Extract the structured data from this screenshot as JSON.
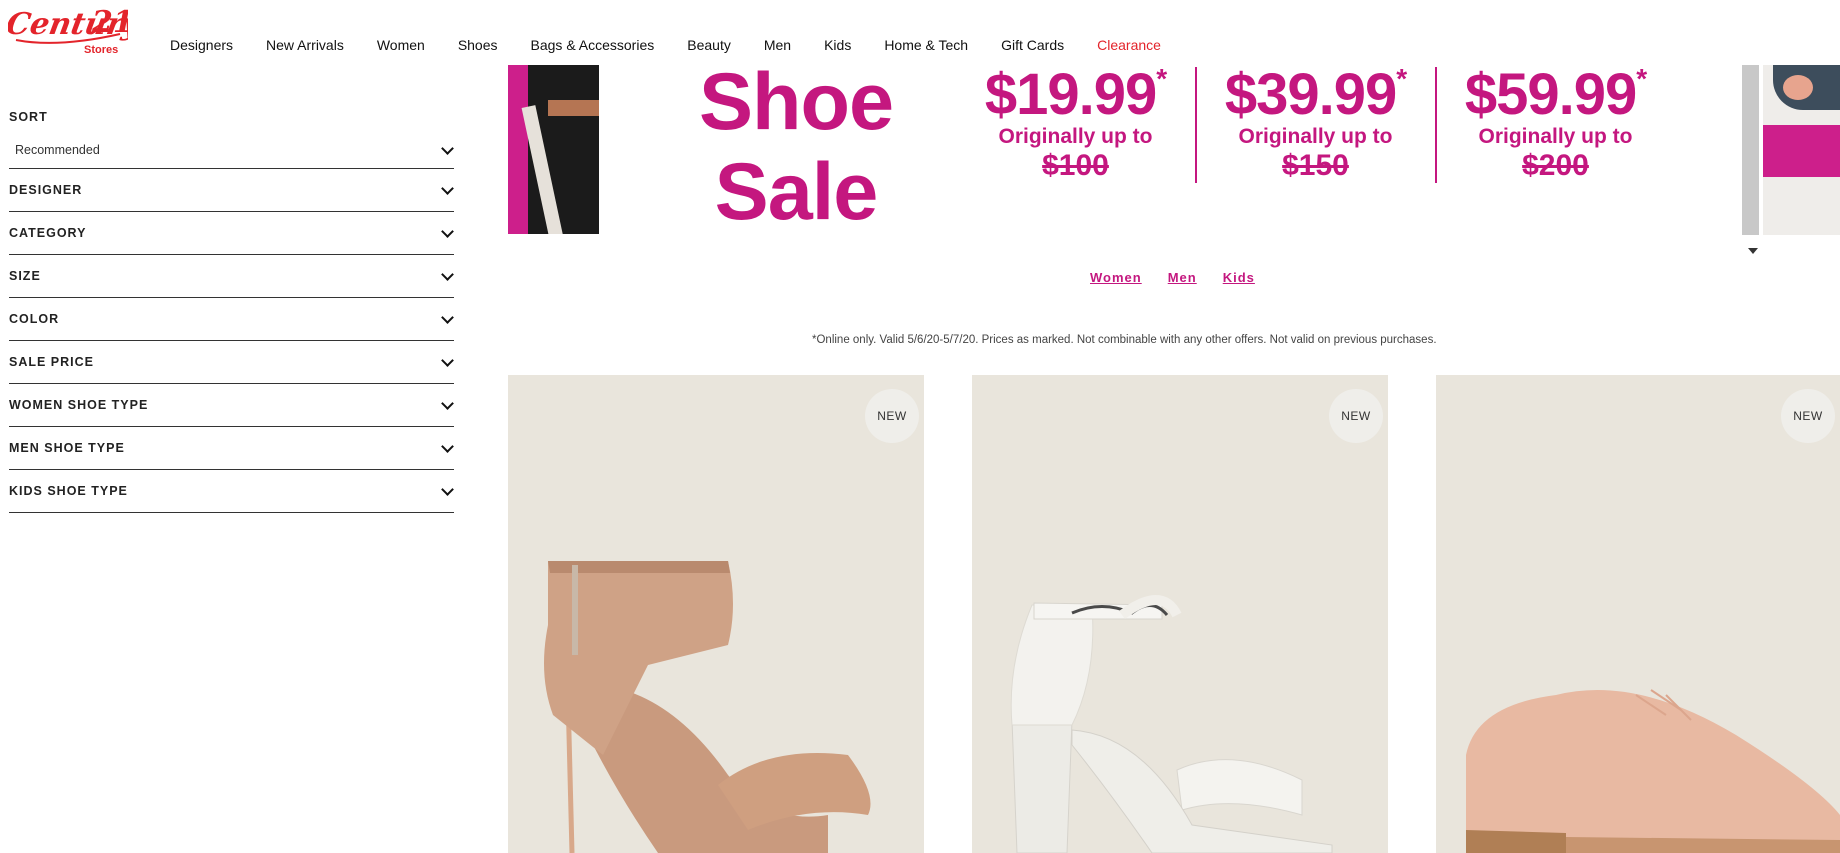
{
  "header": {
    "logo_text": "Century 21",
    "logo_sub": "Stores",
    "nav": [
      "Designers",
      "New Arrivals",
      "Women",
      "Shoes",
      "Bags & Accessories",
      "Beauty",
      "Men",
      "Kids",
      "Home & Tech",
      "Gift Cards",
      "Clearance"
    ]
  },
  "sidebar": {
    "sort_label": "SORT",
    "sort_value": "Recommended",
    "filters": [
      "DESIGNER",
      "CATEGORY",
      "SIZE",
      "COLOR",
      "SALE PRICE",
      "WOMEN SHOE TYPE",
      "MEN SHOE TYPE",
      "KIDS SHOE TYPE"
    ]
  },
  "banner": {
    "title_line1": "Shoe",
    "title_line2": "Sale",
    "asterisk": "*",
    "deals": [
      {
        "price": "$19.99",
        "orig_label": "Originally up to",
        "was": "$100"
      },
      {
        "price": "$39.99",
        "orig_label": "Originally up to",
        "was": "$150"
      },
      {
        "price": "$59.99",
        "orig_label": "Originally up to",
        "was": "$200"
      }
    ],
    "accent_color": "#c4177f"
  },
  "category_links": [
    "Women",
    "Men",
    "Kids"
  ],
  "disclaimer": "*Online only. Valid 5/6/20-5/7/20. Prices as marked. Not combinable with any other offers. Not valid on previous purchases.",
  "products": [
    {
      "badge": "NEW"
    },
    {
      "badge": "NEW"
    },
    {
      "badge": "NEW"
    }
  ]
}
